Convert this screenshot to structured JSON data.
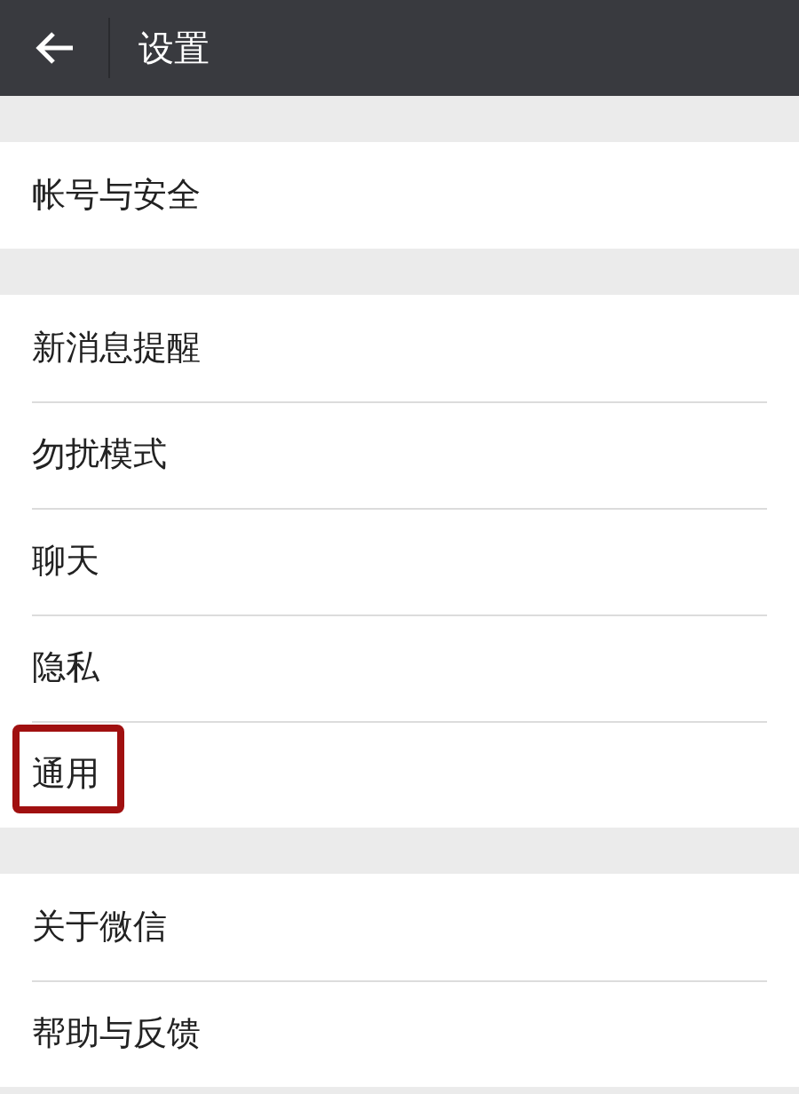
{
  "header": {
    "title": "设置"
  },
  "groups": [
    {
      "items": [
        {
          "label": "帐号与安全",
          "highlighted": false
        }
      ]
    },
    {
      "items": [
        {
          "label": "新消息提醒",
          "highlighted": false
        },
        {
          "label": "勿扰模式",
          "highlighted": false
        },
        {
          "label": "聊天",
          "highlighted": false
        },
        {
          "label": "隐私",
          "highlighted": false
        },
        {
          "label": "通用",
          "highlighted": true
        }
      ]
    },
    {
      "items": [
        {
          "label": "关于微信",
          "highlighted": false
        },
        {
          "label": "帮助与反馈",
          "highlighted": false
        }
      ]
    }
  ]
}
